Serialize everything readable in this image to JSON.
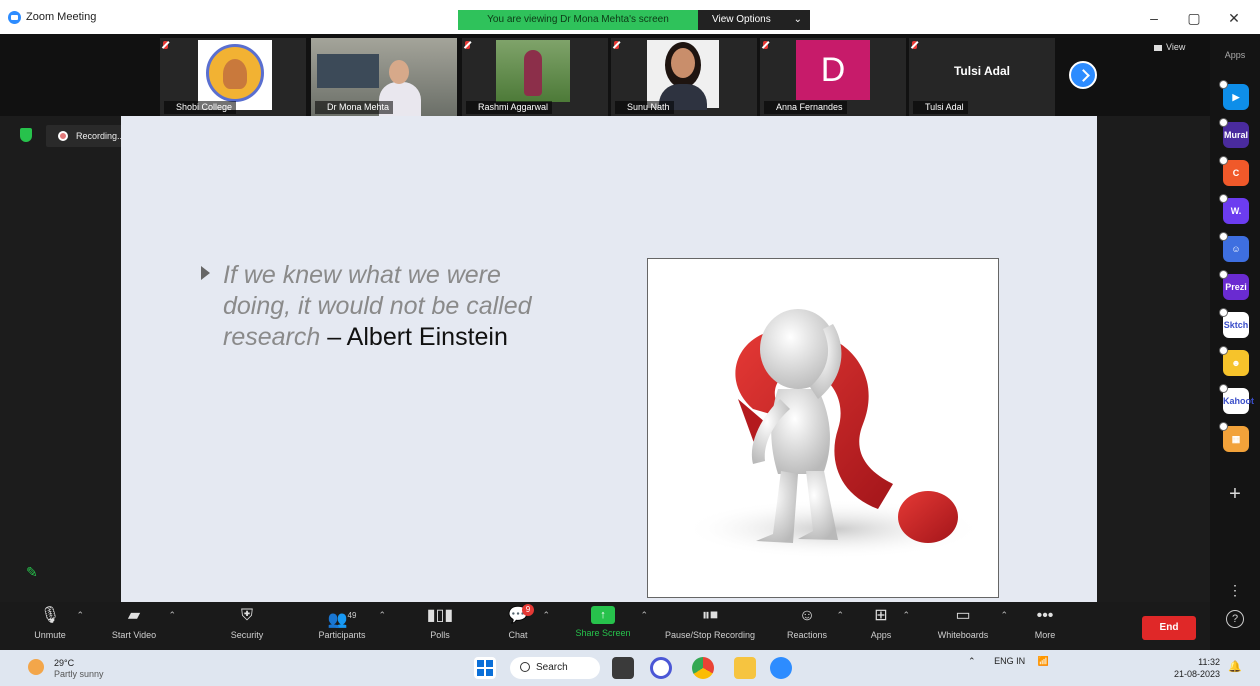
{
  "window": {
    "title": "Zoom Meeting",
    "banner": "You are viewing Dr Mona Mehta's screen",
    "view_options": "View Options",
    "minimize": "–",
    "restore": "▢",
    "close": "✕"
  },
  "participants": [
    {
      "name": "Shobi College",
      "kind": "logo"
    },
    {
      "name": "Dr Mona Mehta",
      "kind": "video"
    },
    {
      "name": "Rashmi Aggarwal",
      "kind": "photo"
    },
    {
      "name": "Sunu Nath",
      "kind": "photo2"
    },
    {
      "name": "Anna Fernandes",
      "kind": "initial",
      "initial": "D"
    },
    {
      "name": "Tulsi Adal",
      "kind": "text",
      "display_name": "Tulsi Adal"
    }
  ],
  "view_button": "View",
  "recording": {
    "label": "Recording...",
    "pause": "❚❚",
    "stop": "■"
  },
  "slide": {
    "quote_lines": [
      "If we knew what we were",
      "doing, it would not be called",
      "research"
    ],
    "attribution": " – Albert Einstein"
  },
  "apps_panel": {
    "label": "Apps",
    "apps": [
      {
        "name": "app-blue",
        "color": "#0e8ee9",
        "text": "▶"
      },
      {
        "name": "app-mural",
        "color": "#4a2b9e",
        "text": "Mural"
      },
      {
        "name": "app-orange",
        "color": "#f0592a",
        "text": "C"
      },
      {
        "name": "app-wordwall",
        "color": "#6c3cf0",
        "text": "W."
      },
      {
        "name": "app-headset",
        "color": "#3e6fe0",
        "text": "☺"
      },
      {
        "name": "app-prezi",
        "color": "#6a2bd1",
        "text": "Prezi"
      },
      {
        "name": "app-sketch",
        "color": "#ffffff",
        "text": "Sktch"
      },
      {
        "name": "app-emoji",
        "color": "#f6c32b",
        "text": "☻"
      },
      {
        "name": "app-kahoot",
        "color": "#ffffff",
        "text": "Kahoot"
      },
      {
        "name": "app-grid",
        "color": "#f2a23a",
        "text": "▦"
      }
    ]
  },
  "toolbar": {
    "unmute": "Unmute",
    "start_video": "Start Video",
    "security": "Security",
    "participants": "Participants",
    "participants_count": "49",
    "polls": "Polls",
    "chat": "Chat",
    "chat_badge": "9",
    "share_screen": "Share Screen",
    "pause_stop_recording": "Pause/Stop Recording",
    "reactions": "Reactions",
    "apps": "Apps",
    "whiteboards": "Whiteboards",
    "more": "More",
    "end": "End"
  },
  "taskbar": {
    "temperature": "29°C",
    "weather": "Partly sunny",
    "search": "Search",
    "lang_top": "ENG",
    "lang_bottom": "IN",
    "time": "11:32",
    "date": "21-08-2023"
  }
}
